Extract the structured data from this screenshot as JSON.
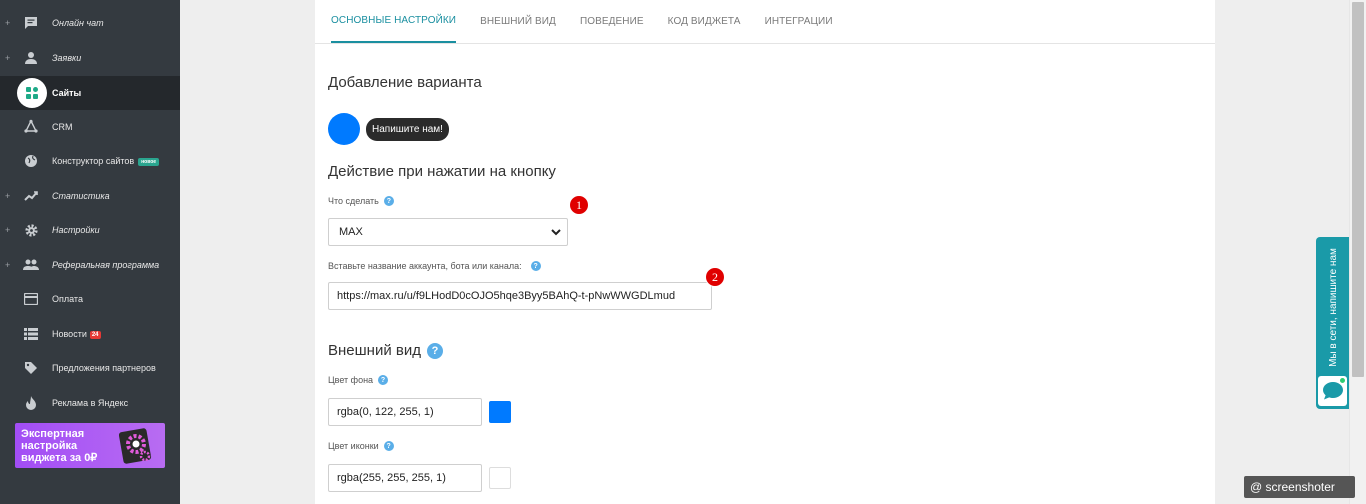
{
  "sidebar": {
    "items": [
      {
        "label": "Онлайн чат",
        "plus": "+",
        "icon": "chat-icon"
      },
      {
        "label": "Заявки",
        "plus": "+",
        "icon": "user-icon"
      },
      {
        "label": "Сайты",
        "plus": "",
        "icon": "apps-icon"
      },
      {
        "label": "CRM",
        "plus": "",
        "icon": "crm-icon"
      },
      {
        "label": "Конструктор сайтов",
        "plus": "",
        "icon": "globe-icon",
        "badge": "новое"
      },
      {
        "label": "Статистика",
        "plus": "+",
        "icon": "trend-icon"
      },
      {
        "label": "Настройки",
        "plus": "+",
        "icon": "gear-icon"
      },
      {
        "label": "Реферальная программа",
        "plus": "+",
        "icon": "group-icon"
      },
      {
        "label": "Оплата",
        "plus": "",
        "icon": "card-icon"
      },
      {
        "label": "Новости",
        "plus": "",
        "icon": "list-icon",
        "count": "24"
      },
      {
        "label": "Предложения партнеров",
        "plus": "",
        "icon": "tag-icon"
      },
      {
        "label": "Реклама в Яндекс",
        "plus": "",
        "icon": "flame-icon"
      }
    ],
    "promo": {
      "line1": "Экспертная",
      "line2": "настройка",
      "line3": "виджета за 0₽"
    }
  },
  "tabs": [
    {
      "label": "ОСНОВНЫЕ НАСТРОЙКИ"
    },
    {
      "label": "ВНЕШНИЙ ВИД"
    },
    {
      "label": "ПОВЕДЕНИЕ"
    },
    {
      "label": "КОД ВИДЖЕТА"
    },
    {
      "label": "ИНТЕГРАЦИИ"
    }
  ],
  "main": {
    "add_variant_title": "Добавление варианта",
    "preview_bubble_text": "Напишите нам!",
    "action_title": "Действие при нажатии на кнопку",
    "what_to_do_label": "Что сделать",
    "what_to_do_value": "MAX",
    "account_label": "Вставьте название аккаунта, бота или канала:",
    "account_value": "https://max.ru/u/f9LHodD0cOJO5hqe3Byy5BAhQ-t-pNwWWGDLmud",
    "appearance_title": "Внешний вид",
    "bg_color_label": "Цвет фона",
    "bg_color_value": "rgba(0, 122, 255, 1)",
    "icon_color_label": "Цвет иконки",
    "icon_color_value": "rgba(255, 255, 255, 1)",
    "help_glyph": "?"
  },
  "markers": {
    "m1": "1",
    "m2": "2"
  },
  "widget": {
    "text": "Мы в сети, напишите нам"
  },
  "watermark": {
    "text": "@ screenshoter"
  },
  "colors": {
    "accent": "#1a8fa0",
    "preview": "#007aff",
    "marker": "#e00000",
    "widget": "#1a9aa8"
  }
}
